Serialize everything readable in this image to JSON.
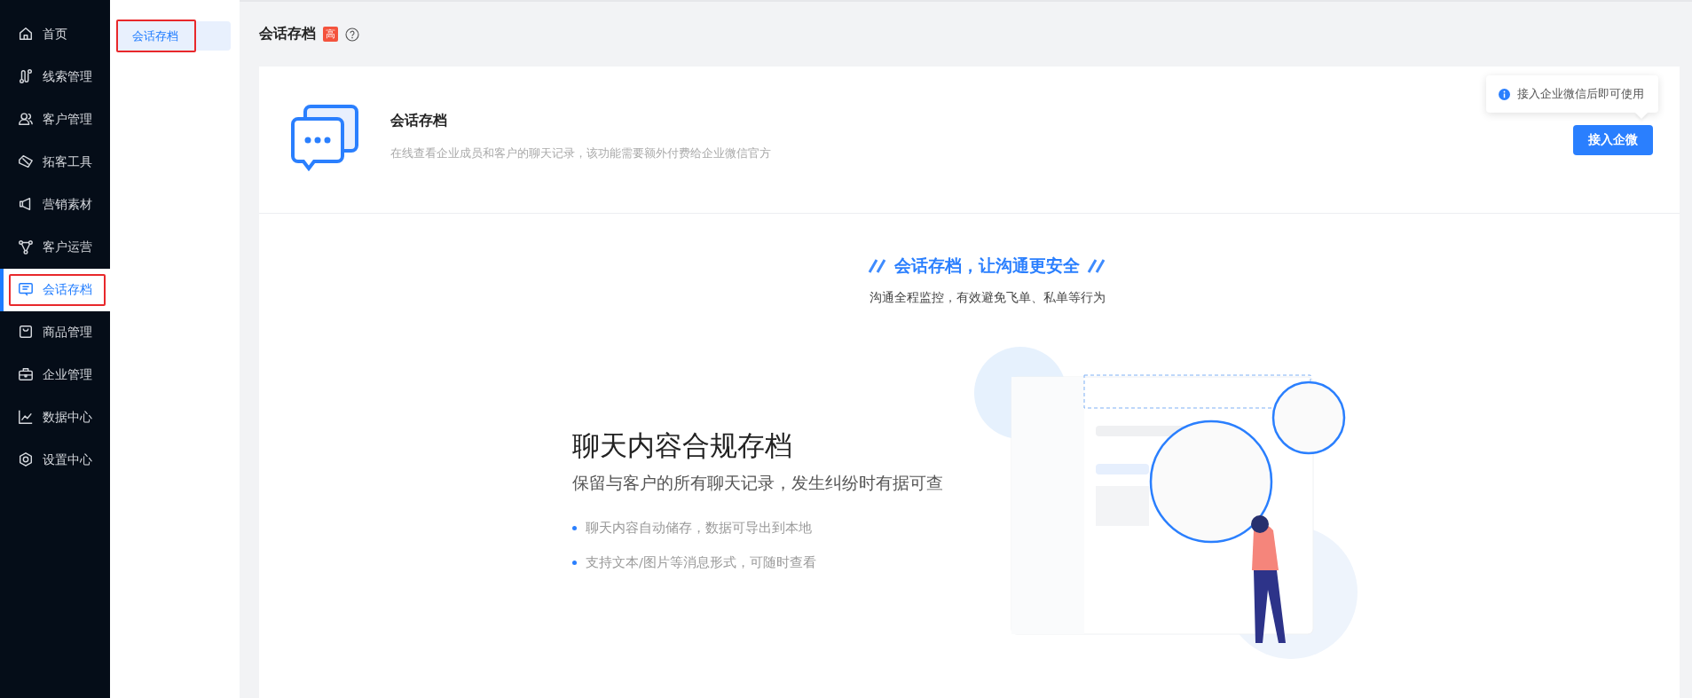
{
  "sidebar": {
    "items": [
      {
        "label": "首页",
        "selected": false,
        "annotated": false
      },
      {
        "label": "线索管理",
        "selected": false,
        "annotated": false
      },
      {
        "label": "客户管理",
        "selected": false,
        "annotated": false
      },
      {
        "label": "拓客工具",
        "selected": false,
        "annotated": false
      },
      {
        "label": "营销素材",
        "selected": false,
        "annotated": false
      },
      {
        "label": "客户运营",
        "selected": false,
        "annotated": false
      },
      {
        "label": "会话存档",
        "selected": true,
        "annotated": true
      },
      {
        "label": "商品管理",
        "selected": false,
        "annotated": false
      },
      {
        "label": "企业管理",
        "selected": false,
        "annotated": false
      },
      {
        "label": "数据中心",
        "selected": false,
        "annotated": false
      },
      {
        "label": "设置中心",
        "selected": false,
        "annotated": false
      }
    ]
  },
  "submenu": {
    "items": [
      {
        "label": "会话存档",
        "selected": true,
        "annotated": true
      }
    ]
  },
  "header": {
    "title": "会话存档",
    "badge": "高"
  },
  "intro_card": {
    "title": "会话存档",
    "description": "在线查看企业成员和客户的聊天记录，该功能需要额外付费给企业微信官方",
    "tooltip": "接入企业微信后即可使用",
    "button": "接入企微"
  },
  "feature": {
    "slogan": "会话存档，让沟通更安全",
    "subtitle": "沟通全程监控，有效避免飞单、私单等行为",
    "title": "聊天内容合规存档",
    "lead": "保留与客户的所有聊天记录，发生纠纷时有据可查",
    "bullets": [
      "聊天内容自动储存，数据可导出到本地",
      "支持文本/图片等消息形式，可随时查看"
    ]
  }
}
